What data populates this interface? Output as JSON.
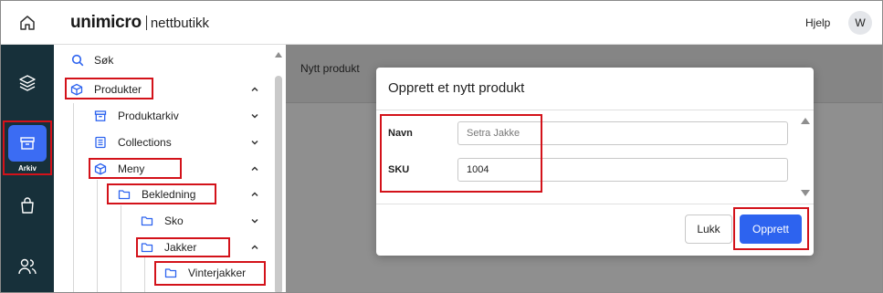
{
  "header": {
    "logo_main": "unimicro",
    "logo_sub": "nettbutikk",
    "help_label": "Hjelp",
    "avatar_initial": "W",
    "icons": {
      "home": "home-icon"
    }
  },
  "rail": {
    "items": [
      {
        "name": "layers",
        "icon": "layers-icon"
      },
      {
        "name": "archive",
        "icon": "archive-icon",
        "label": "Arkiv",
        "active": true
      },
      {
        "name": "shopping",
        "icon": "shopping-bag-icon"
      },
      {
        "name": "users",
        "icon": "users-icon"
      }
    ],
    "active_color": "#3b6cf3",
    "background": "#17303a"
  },
  "nav": {
    "items": [
      {
        "label": "Søk",
        "icon": "search-icon"
      },
      {
        "label": "Produkter",
        "icon": "cube-icon",
        "chevron": "up"
      },
      {
        "label": "Produktarkiv",
        "icon": "archive-icon",
        "chevron": "down"
      },
      {
        "label": "Collections",
        "icon": "list-icon",
        "chevron": "down"
      },
      {
        "label": "Meny",
        "icon": "cube-icon",
        "chevron": "up"
      },
      {
        "label": "Bekledning",
        "icon": "folder-icon",
        "chevron": "up"
      },
      {
        "label": "Sko",
        "icon": "folder-icon",
        "chevron": "down"
      },
      {
        "label": "Jakker",
        "icon": "folder-icon",
        "chevron": "up"
      },
      {
        "label": "Vinterjakker",
        "icon": "folder-icon"
      }
    ]
  },
  "main": {
    "page_title": "Nytt produkt"
  },
  "modal": {
    "title": "Opprett et nytt produkt",
    "fields": [
      {
        "label": "Navn",
        "value": "",
        "placeholder": "Setra Jakke"
      },
      {
        "label": "SKU",
        "value": "1004",
        "placeholder": ""
      }
    ],
    "buttons": {
      "close_label": "Lukk",
      "create_label": "Opprett"
    },
    "accent": "#2d63ef"
  },
  "highlight_color": "#d3121a"
}
